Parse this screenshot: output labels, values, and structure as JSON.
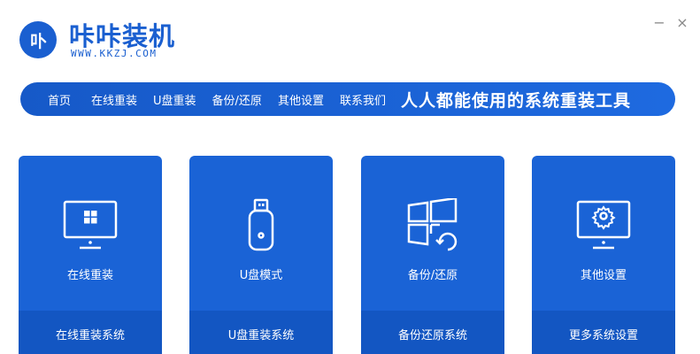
{
  "app": {
    "logo_mark": "卟",
    "title": "咔咔装机",
    "url": "WWW.KKZJ.COM"
  },
  "window_controls": {
    "minimize": "−",
    "close": "×"
  },
  "nav": {
    "items": [
      {
        "label": "首页"
      },
      {
        "label": "在线重装"
      },
      {
        "label": "U盘重装"
      },
      {
        "label": "备份/还原"
      },
      {
        "label": "其他设置"
      },
      {
        "label": "联系我们"
      }
    ],
    "slogan": "人人都能使用的系统重装工具"
  },
  "cards": [
    {
      "icon": "monitor-windows-icon",
      "label": "在线重装",
      "footer": "在线重装系统"
    },
    {
      "icon": "usb-drive-icon",
      "label": "U盘模式",
      "footer": "U盘重装系统"
    },
    {
      "icon": "windows-restore-icon",
      "label": "备份/还原",
      "footer": "备份还原系统"
    },
    {
      "icon": "monitor-gear-icon",
      "label": "其他设置",
      "footer": "更多系统设置"
    }
  ],
  "colors": {
    "brand": "#1a5fd0",
    "card": "#1a63d6",
    "card_footer": "#1356c2"
  }
}
